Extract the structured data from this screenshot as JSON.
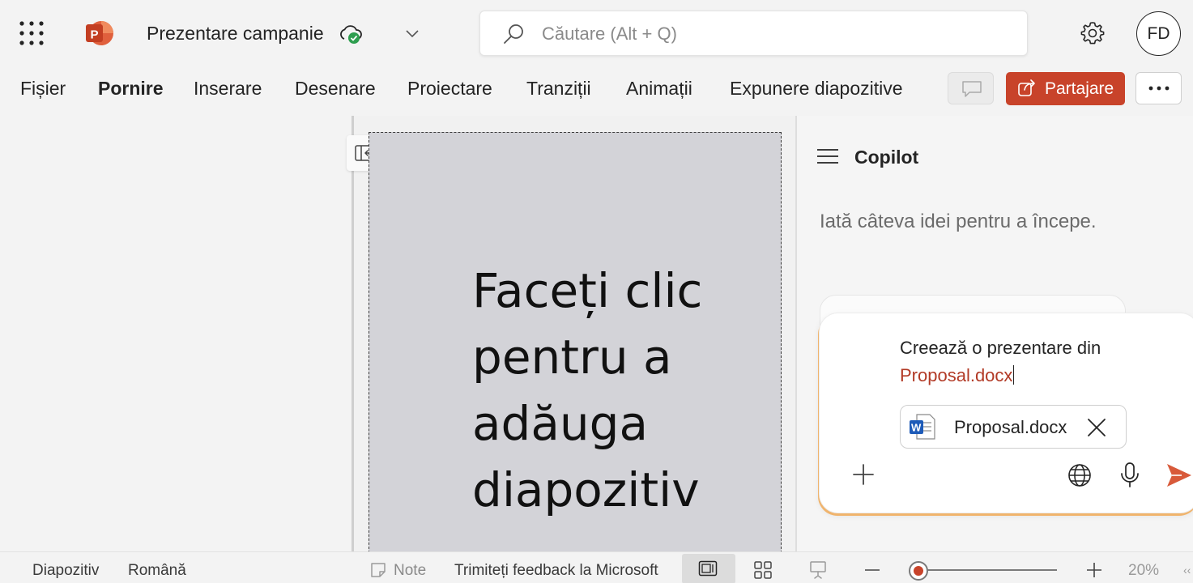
{
  "app": {
    "doc_title": "Prezentare campanie",
    "brand_color": "#c8432a",
    "icons": [
      "waffle-icon",
      "powerpoint-logo-icon",
      "cloud-saved-icon",
      "chevron-down-icon",
      "search-icon",
      "gear-icon"
    ]
  },
  "search": {
    "placeholder": "Căutare (Alt + Q)"
  },
  "user": {
    "initials": "FD"
  },
  "ribbon": {
    "tabs": [
      {
        "label": "Fișier",
        "active": false
      },
      {
        "label": "Pornire",
        "active": true
      },
      {
        "label": "Inserare",
        "active": false
      },
      {
        "label": "Desenare",
        "active": false
      },
      {
        "label": "Proiectare",
        "active": false
      },
      {
        "label": "Tranziții",
        "active": false
      },
      {
        "label": "Animații",
        "active": false
      },
      {
        "label": "Expunere diapozitive",
        "active": false
      }
    ],
    "share_label": "Partajare"
  },
  "slide": {
    "placeholder_text": "Faceți clic pentru a adăuga diapozitiv",
    "background": "#d3d3d8"
  },
  "copilot": {
    "title": "Copilot",
    "hint": "Iată câteva idei pentru a începe.",
    "prompt_text": "Creează o prezentare din",
    "prompt_reference": "Proposal.docx",
    "reference_color": "#b23a26",
    "attachment": {
      "name": "Proposal.docx",
      "type": "word-document-icon"
    }
  },
  "status": {
    "slide_label": "Diapozitiv",
    "language": "Română",
    "notes_label": "Note",
    "feedback": "Trimiteți feedback la Microsoft",
    "zoom_level": 20,
    "zoom_text": "20%"
  }
}
